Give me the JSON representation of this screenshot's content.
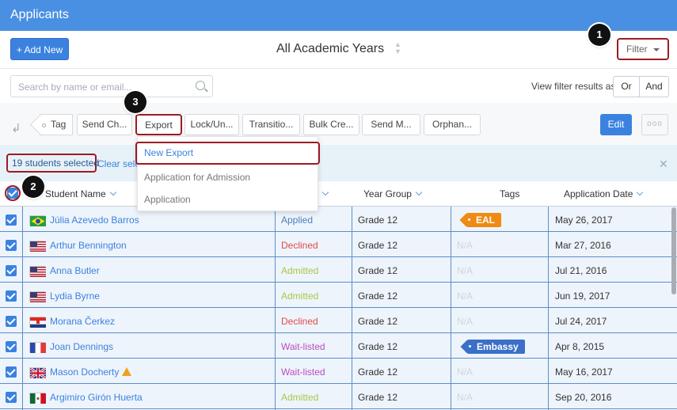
{
  "header": {
    "title": "Applicants"
  },
  "actions": {
    "add_new": "+ Add New",
    "academic_years": "All Academic Years",
    "filter": "Filter"
  },
  "search": {
    "placeholder": "Search by name or email..."
  },
  "view_filter": {
    "label": "View filter results as:",
    "or": "Or",
    "and": "And"
  },
  "callouts": [
    "1",
    "2",
    "3"
  ],
  "toolbar": {
    "tag": "Tag",
    "send_checklist": "Send Ch...",
    "export": "Export",
    "lock_unlock": "Lock/Un...",
    "transition": "Transitio...",
    "bulk_create": "Bulk Cre...",
    "send_message": "Send M...",
    "orphan": "Orphan...",
    "edit": "Edit",
    "more": "ooo"
  },
  "selection": {
    "count_text": "19 students selected",
    "clear_text": "Clear selection"
  },
  "export_menu": {
    "items": [
      "New Export",
      "Application for Admission",
      "Application"
    ]
  },
  "table": {
    "columns": {
      "student_name": "Student Name",
      "year_group": "Year Group",
      "tags": "Tags",
      "application_date": "Application Date"
    },
    "rows": [
      {
        "name": "Júlia Azevedo Barros",
        "flag": "brazil",
        "status": "Applied",
        "year_group": "Grade 12",
        "tag": "EAL",
        "date": "May 26, 2017"
      },
      {
        "name": "Arthur Bennington",
        "flag": "usa",
        "status": "Declined",
        "year_group": "Grade 12",
        "tag": "N/A",
        "date": "Mar 27, 2016"
      },
      {
        "name": "Anna Butler",
        "flag": "usa",
        "status": "Admitted",
        "year_group": "Grade 12",
        "tag": "N/A",
        "date": "Jul 21, 2016"
      },
      {
        "name": "Lydia Byrne",
        "flag": "usa",
        "status": "Admitted",
        "year_group": "Grade 12",
        "tag": "N/A",
        "date": "Jun 19, 2017"
      },
      {
        "name": "Morana Čerkez",
        "flag": "croatia",
        "status": "Declined",
        "year_group": "Grade 12",
        "tag": "N/A",
        "date": "Jul 24, 2017"
      },
      {
        "name": "Joan Dennings",
        "flag": "france",
        "status": "Wait-listed",
        "year_group": "Grade 12",
        "tag": "Embassy",
        "date": "Apr 8, 2015"
      },
      {
        "name": "Mason Docherty",
        "flag": "uk",
        "status": "Wait-listed",
        "year_group": "Grade 12",
        "tag": "N/A",
        "date": "May 16, 2017"
      },
      {
        "name": "Argimiro Girón Huerta",
        "flag": "mexico",
        "status": "Admitted",
        "year_group": "Grade 12",
        "tag": "N/A",
        "date": "Sep 20, 2016"
      }
    ]
  },
  "colors": {
    "primary": "#3b82e0",
    "applied": "#4a7fc1",
    "declined": "#e04b4b",
    "admitted": "#a8c84a",
    "waitlisted": "#b94fc4",
    "eal_tag": "#ef8a12",
    "embassy_tag": "#3b6fc8",
    "highlight_ring": "#9b1c24"
  }
}
